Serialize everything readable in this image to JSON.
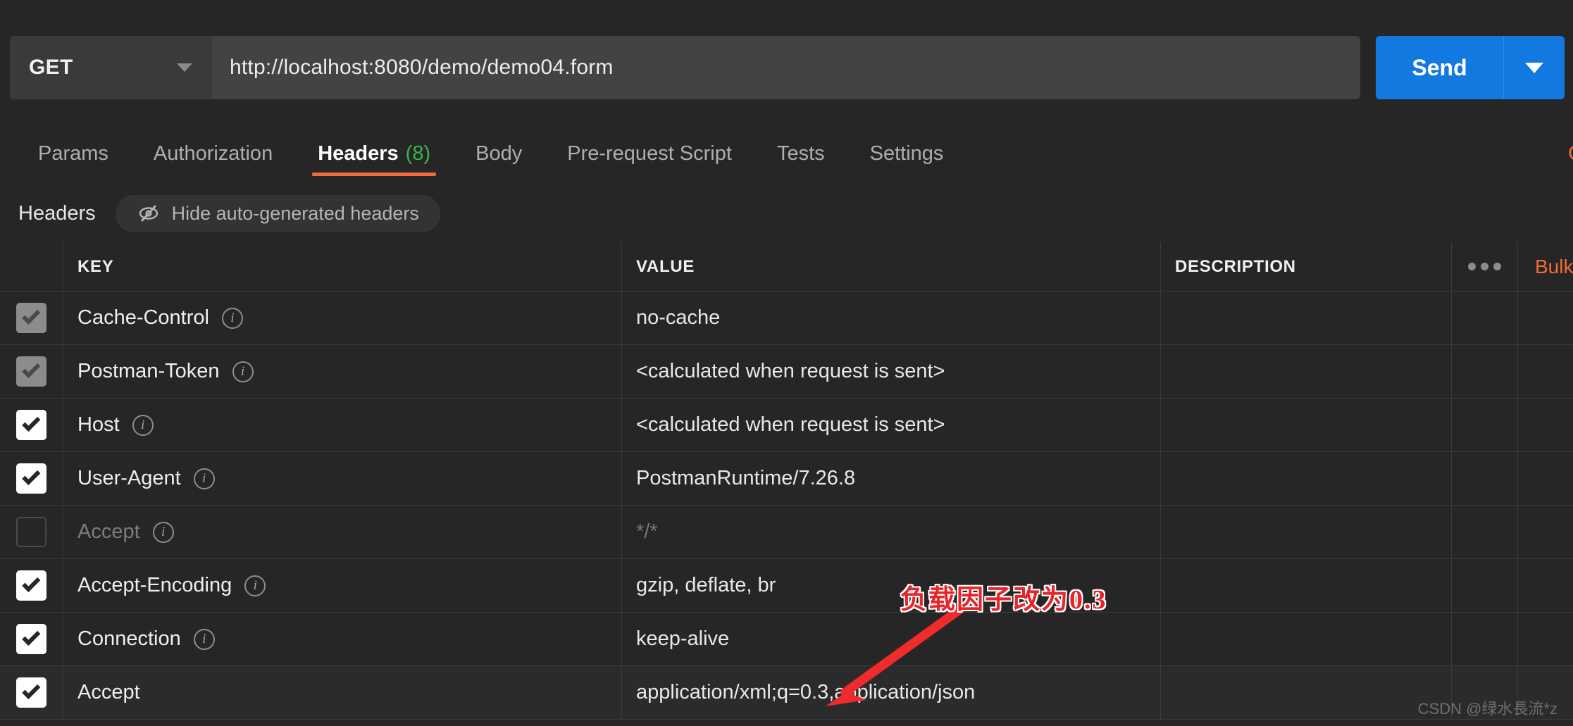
{
  "request": {
    "method": "GET",
    "url": "http://localhost:8080/demo/demo04.form",
    "send_label": "Send",
    "method_caret_icon": "chevron-down-icon",
    "send_caret_icon": "chevron-down-icon"
  },
  "tabs": [
    {
      "label": "Params",
      "count": "",
      "active": false
    },
    {
      "label": "Authorization",
      "count": "",
      "active": false
    },
    {
      "label": "Headers",
      "count": "(8)",
      "active": true
    },
    {
      "label": "Body",
      "count": "",
      "active": false
    },
    {
      "label": "Pre-request Script",
      "count": "",
      "active": false
    },
    {
      "label": "Tests",
      "count": "",
      "active": false
    },
    {
      "label": "Settings",
      "count": "",
      "active": false
    }
  ],
  "cookies_link": "C",
  "subbar": {
    "title": "Headers",
    "hide_label": "Hide auto-generated headers",
    "hide_icon": "eye-off-icon"
  },
  "table": {
    "columns": [
      "KEY",
      "VALUE",
      "DESCRIPTION"
    ],
    "more_icon": "ellipsis-icon",
    "bulk_edit": "Bulk Edit",
    "rows": [
      {
        "checked": "dim",
        "key": "Cache-Control",
        "info": true,
        "value": "no-cache",
        "value_muted": false,
        "description": ""
      },
      {
        "checked": "dim",
        "key": "Postman-Token",
        "info": true,
        "value": "<calculated when request is sent>",
        "value_muted": false,
        "description": ""
      },
      {
        "checked": "on",
        "key": "Host",
        "info": true,
        "value": "<calculated when request is sent>",
        "value_muted": false,
        "description": ""
      },
      {
        "checked": "on",
        "key": "User-Agent",
        "info": true,
        "value": "PostmanRuntime/7.26.8",
        "value_muted": false,
        "description": ""
      },
      {
        "checked": "off",
        "key": "Accept",
        "info": true,
        "value": "*/*",
        "value_muted": true,
        "description": ""
      },
      {
        "checked": "on",
        "key": "Accept-Encoding",
        "info": true,
        "value": "gzip, deflate, br",
        "value_muted": false,
        "description": ""
      },
      {
        "checked": "on",
        "key": "Connection",
        "info": true,
        "value": "keep-alive",
        "value_muted": false,
        "description": ""
      },
      {
        "checked": "on",
        "key": "Accept",
        "info": false,
        "value": "application/xml;q=0.3,application/json",
        "value_muted": false,
        "description": ""
      }
    ]
  },
  "annotation": {
    "text": "负载因子改为0.3",
    "color": "#e8232a",
    "arrow_icon": "arrow-down-left-icon"
  },
  "watermark": "CSDN @绿水長流*z"
}
